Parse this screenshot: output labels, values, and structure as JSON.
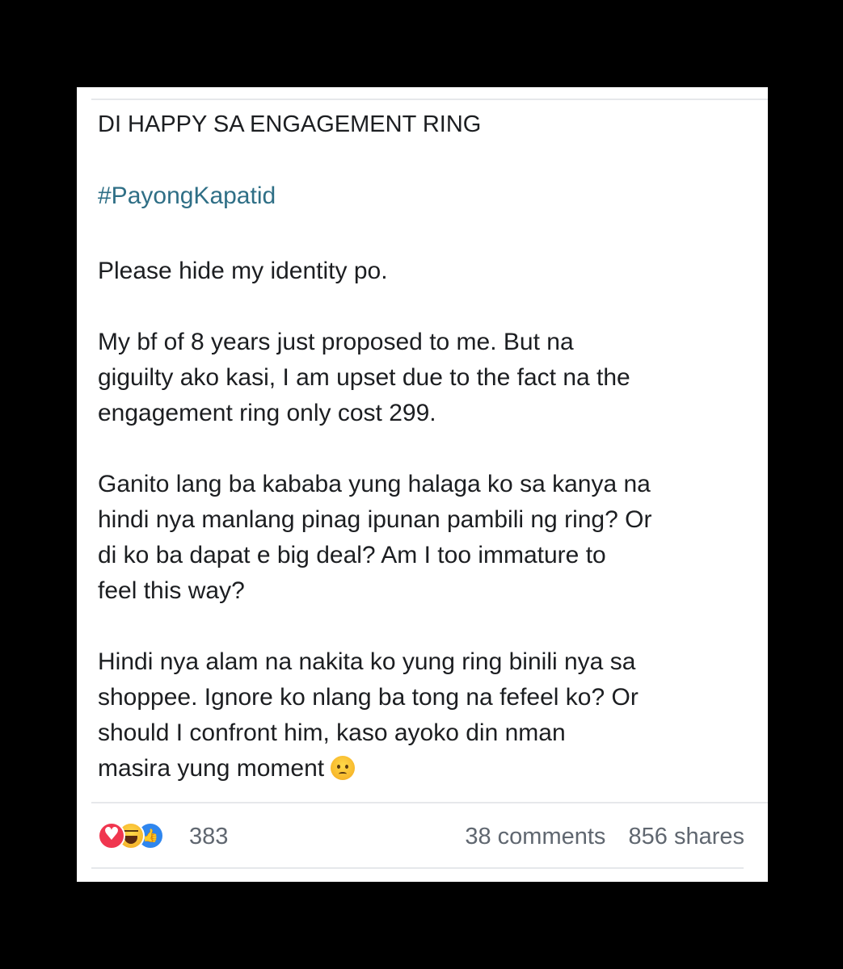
{
  "post": {
    "title": "DI HAPPY SA ENGAGEMENT RING",
    "hashtag": "#PayongKapatid",
    "paragraphs": [
      "Please hide my identity po.",
      "My bf of 8 years just proposed to me. But na\ngiguilty ako kasi, I am upset due to the fact na the\nengagement ring only cost 299.",
      "Ganito lang ba kababa yung halaga ko sa kanya na\nhindi nya manlang pinag ipunan pambili ng ring? Or\ndi ko ba dapat e big deal? Am I too immature to\nfeel this way?",
      "Hindi nya alam na nakita ko yung ring binili nya sa\nshoppee. Ignore ko nlang ba tong na fefeel ko? Or\nshould I confront him, kaso ayoko din nman\nmasira yung moment"
    ],
    "trailing_emoji": "frowning-face-icon"
  },
  "footer": {
    "reactions": [
      "love-icon",
      "haha-icon",
      "like-icon"
    ],
    "reaction_count": "383",
    "comments": "38 comments",
    "shares": "856 shares"
  },
  "colors": {
    "background": "#000000",
    "card": "#ffffff",
    "hashtag": "#2f6f86",
    "text": "#1c1e21",
    "meta_text": "#606770",
    "love": "#f0364f",
    "like": "#2f86ee"
  }
}
